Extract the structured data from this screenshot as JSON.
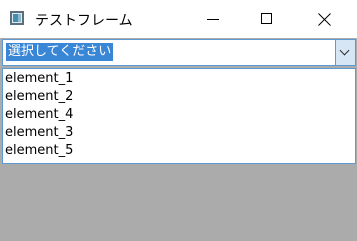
{
  "window": {
    "title": "テストフレーム",
    "controls": {
      "minimize": "minimize-icon",
      "maximize": "maximize-icon",
      "close": "close-icon"
    }
  },
  "combo": {
    "selected_value": "選択してください",
    "options": [
      "element_1",
      "element_2",
      "element_4",
      "element_3",
      "element_5"
    ]
  },
  "colors": {
    "selection": "#3a86d6",
    "combo_border": "#5c9ad1",
    "background": "#ababab"
  }
}
